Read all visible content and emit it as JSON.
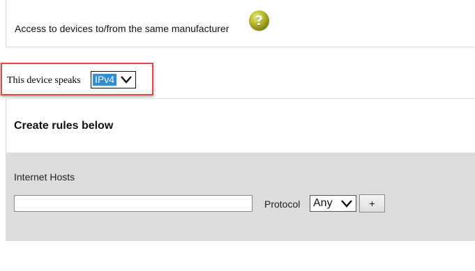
{
  "access": {
    "label": "Access to devices to/from the same manufacturer",
    "help_icon": "question-mark-help-icon",
    "help_glyph": "?"
  },
  "device": {
    "speaks_label": "This device speaks",
    "ip_version_selected": "IPv4"
  },
  "rules": {
    "title": "Create rules below",
    "hosts_label": "Internet Hosts",
    "hosts_value": "",
    "protocol_label": "Protocol",
    "protocol_selected": "Any",
    "add_button_label": "+"
  },
  "colors": {
    "highlight_border": "#e04848",
    "selection_bg": "#2f8ed8",
    "panel_bg": "#dcdcdc"
  }
}
